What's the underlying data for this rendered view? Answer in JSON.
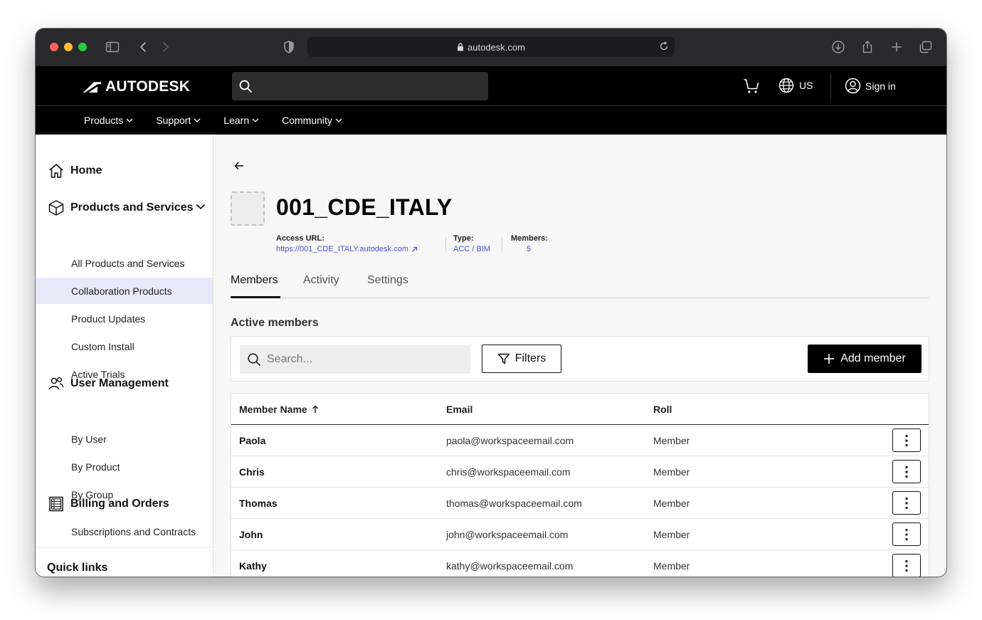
{
  "browser": {
    "url": "autodesk.com"
  },
  "header": {
    "brand": "AUTODESK",
    "region": "US",
    "sign_in": "Sign in",
    "nav": [
      {
        "label": "Products"
      },
      {
        "label": "Support"
      },
      {
        "label": "Learn"
      },
      {
        "label": "Community"
      }
    ]
  },
  "sidebar": {
    "home": "Home",
    "products_services": {
      "label": "Products and Services",
      "items": [
        {
          "label": "All Products and Services"
        },
        {
          "label": "Collaboration Products",
          "active": true
        },
        {
          "label": "Product Updates"
        },
        {
          "label": "Custom Install"
        },
        {
          "label": "Active Trials"
        }
      ]
    },
    "user_management": {
      "label": "User Management",
      "items": [
        {
          "label": "By User"
        },
        {
          "label": "By Product"
        },
        {
          "label": "By Group"
        }
      ]
    },
    "billing": {
      "label": "Billing and Orders",
      "items": [
        {
          "label": "Subscriptions and Contracts"
        }
      ]
    },
    "quick_links": "Quick links"
  },
  "project": {
    "title": "001_CDE_ITALY",
    "access_url_label": "Access URL:",
    "access_url": "https://001_CDE_ITALY.autodesk.com",
    "type_label": "Type:",
    "type": "ACC / BIM",
    "members_label": "Members:",
    "members": "5"
  },
  "tabs": [
    {
      "label": "Members",
      "active": true
    },
    {
      "label": "Activity"
    },
    {
      "label": "Settings"
    }
  ],
  "members_section": {
    "title": "Active members",
    "search_placeholder": "Search...",
    "filters_label": "Filters",
    "add_member_label": "Add member",
    "columns": [
      "Member Name",
      "Email",
      "Roll"
    ],
    "rows": [
      {
        "name": "Paola",
        "email": "paola@workspaceemail.com",
        "role": "Member"
      },
      {
        "name": "Chris",
        "email": "chris@workspaceemail.com",
        "role": "Member"
      },
      {
        "name": "Thomas",
        "email": "thomas@workspaceemail.com",
        "role": "Member"
      },
      {
        "name": "John",
        "email": "john@workspaceemail.com",
        "role": "Member"
      },
      {
        "name": "Kathy",
        "email": "kathy@workspaceemail.com",
        "role": "Member"
      }
    ]
  },
  "colors": {
    "accent_link": "#4a4fd1",
    "active_nav_bg": "#e7e8f8",
    "header_bg": "#000000"
  }
}
